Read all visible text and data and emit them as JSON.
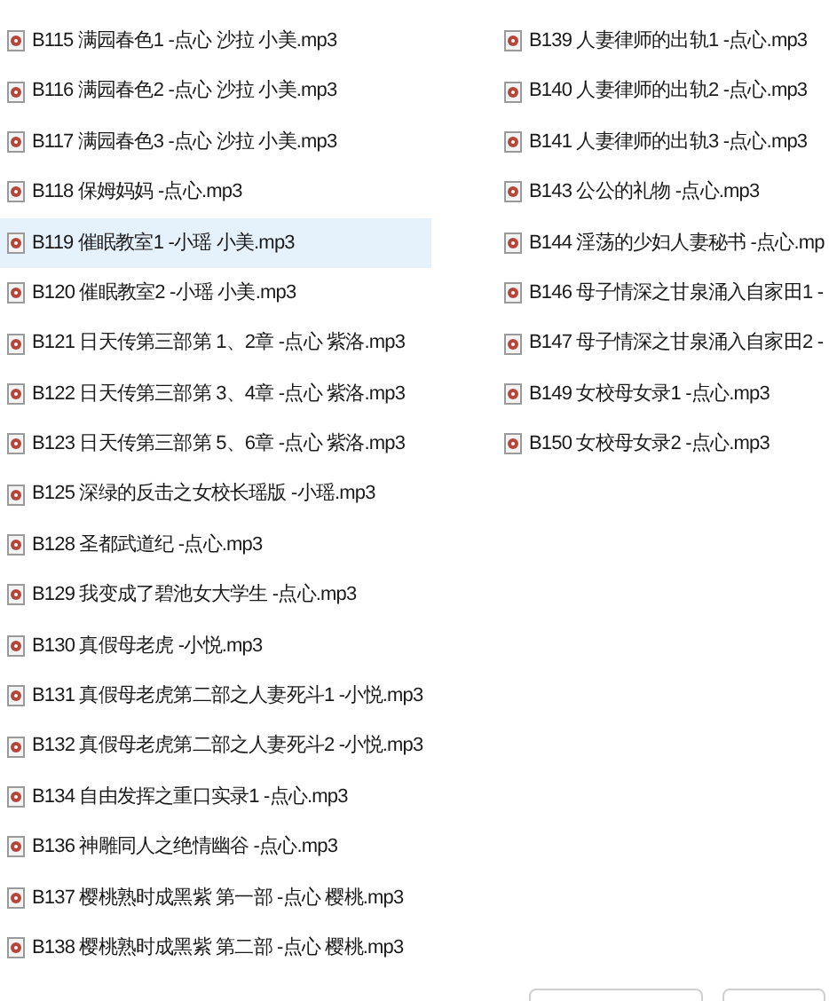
{
  "columns": [
    {
      "items": [
        {
          "name": "B115 满园春色1 -点心 沙拉 小美.mp3",
          "selected": false
        },
        {
          "name": "B116 满园春色2 -点心 沙拉 小美.mp3",
          "selected": false
        },
        {
          "name": "B117 满园春色3 -点心 沙拉 小美.mp3",
          "selected": false
        },
        {
          "name": "B118 保姆妈妈 -点心.mp3",
          "selected": false
        },
        {
          "name": "B119 催眠教室1 -小瑶 小美.mp3",
          "selected": true
        },
        {
          "name": "B120 催眠教室2 -小瑶 小美.mp3",
          "selected": false
        },
        {
          "name": "B121 日天传第三部第 1、2章 -点心 紫洛.mp3",
          "selected": false
        },
        {
          "name": "B122 日天传第三部第 3、4章 -点心 紫洛.mp3",
          "selected": false
        },
        {
          "name": "B123 日天传第三部第 5、6章 -点心 紫洛.mp3",
          "selected": false
        },
        {
          "name": "B125 深绿的反击之女校长瑶版 -小瑶.mp3",
          "selected": false
        },
        {
          "name": "B128 圣都武道纪 -点心.mp3",
          "selected": false
        },
        {
          "name": "B129 我变成了碧池女大学生 -点心.mp3",
          "selected": false
        },
        {
          "name": "B130 真假母老虎 -小悦.mp3",
          "selected": false
        },
        {
          "name": "B131 真假母老虎第二部之人妻死斗1 -小悦.mp3",
          "selected": false
        },
        {
          "name": "B132 真假母老虎第二部之人妻死斗2 -小悦.mp3",
          "selected": false
        },
        {
          "name": "B134 自由发挥之重口实录1 -点心.mp3",
          "selected": false
        },
        {
          "name": "B136 神雕同人之绝情幽谷 -点心.mp3",
          "selected": false
        },
        {
          "name": "B137 樱桃熟时成黑紫 第一部 -点心 樱桃.mp3",
          "selected": false
        },
        {
          "name": "B138 樱桃熟时成黑紫 第二部 -点心 樱桃.mp3",
          "selected": false
        }
      ]
    },
    {
      "items": [
        {
          "name": "B139 人妻律师的出轨1 -点心.mp3",
          "selected": false
        },
        {
          "name": "B140 人妻律师的出轨2 -点心.mp3",
          "selected": false
        },
        {
          "name": "B141 人妻律师的出轨3 -点心.mp3",
          "selected": false
        },
        {
          "name": "B143 公公的礼物 -点心.mp3",
          "selected": false
        },
        {
          "name": "B144 淫荡的少妇人妻秘书 -点心.mp",
          "selected": false
        },
        {
          "name": "B146 母子情深之甘泉涌入自家田1 -",
          "selected": false
        },
        {
          "name": "B147 母子情深之甘泉涌入自家田2 -",
          "selected": false
        },
        {
          "name": "B149 女校母女录1 -点心.mp3",
          "selected": false
        },
        {
          "name": "B150 女校母女录2 -点心.mp3",
          "selected": false
        }
      ]
    }
  ]
}
